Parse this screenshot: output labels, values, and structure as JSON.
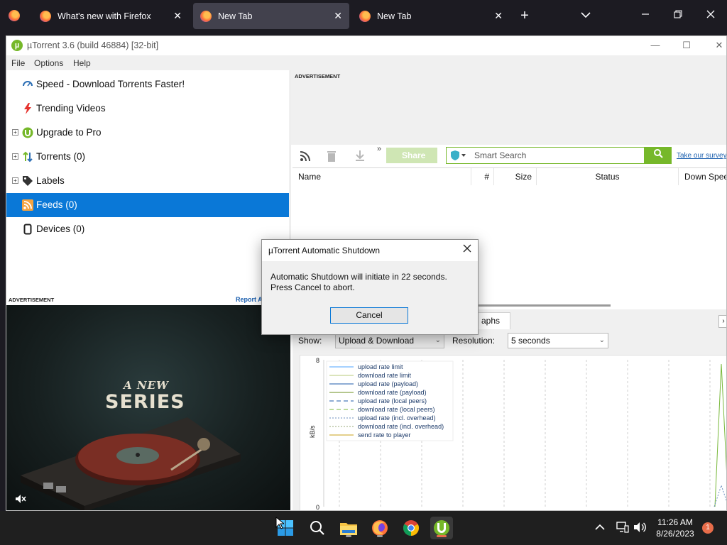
{
  "browser": {
    "tabs": [
      {
        "label": "What's new with Firefox",
        "active": false
      },
      {
        "label": "New Tab",
        "active": true
      },
      {
        "label": "New Tab",
        "active": false
      }
    ]
  },
  "app": {
    "title": "µTorrent 3.6  (build 46884) [32-bit]",
    "menu": [
      "File",
      "Options",
      "Help"
    ]
  },
  "sidebar": {
    "items": [
      {
        "label": "Speed - Download Torrents Faster!",
        "icon": "speed-gauge-icon"
      },
      {
        "label": "Trending Videos",
        "icon": "lightning-icon"
      },
      {
        "label": "Upgrade to Pro",
        "icon": "utorrent-logo-icon"
      },
      {
        "label": "Torrents (0)",
        "icon": "torrents-arrows-icon"
      },
      {
        "label": "Labels",
        "icon": "tag-icon"
      },
      {
        "label": "Feeds (0)",
        "icon": "rss-icon",
        "selected": true
      },
      {
        "label": "Devices (0)",
        "icon": "device-icon"
      }
    ]
  },
  "ads": {
    "left_label": "ADVERTISEMENT",
    "report_label": "Report A",
    "video_line1": "A NEW",
    "video_line2": "SERIES",
    "right_label": "ADVERTISEMENT"
  },
  "toolbar": {
    "share_label": "Share",
    "search_placeholder": "Smart Search",
    "survey_link": "Take our survey"
  },
  "table": {
    "columns": [
      "Name",
      "#",
      "Size",
      "Status",
      "Down Speed"
    ]
  },
  "details": {
    "tab_fragment": "aphs",
    "show_label": "Show:",
    "show_value": "Upload & Download",
    "resolution_label": "Resolution:",
    "resolution_value": "5 seconds"
  },
  "chart_data": {
    "type": "line",
    "ylabel": "kB/s",
    "ylim": [
      0,
      8
    ],
    "yticks": [
      "8",
      "0"
    ],
    "legend_position": "top-left",
    "series": [
      {
        "name": "upload rate limit",
        "color": "#4da3ff",
        "style": "solid"
      },
      {
        "name": "download rate limit",
        "color": "#b7c97a",
        "style": "solid"
      },
      {
        "name": "upload rate (payload)",
        "color": "#1e5aa8",
        "style": "solid"
      },
      {
        "name": "download rate (payload)",
        "color": "#6b8f1d",
        "style": "solid"
      },
      {
        "name": "upload rate (local peers)",
        "color": "#1e5aa8",
        "style": "dashed"
      },
      {
        "name": "download rate (local peers)",
        "color": "#78b83a",
        "style": "dashed"
      },
      {
        "name": "upload rate (incl. overhead)",
        "color": "#6b8fbf",
        "style": "dotted"
      },
      {
        "name": "download rate (incl. overhead)",
        "color": "#9aa87a",
        "style": "dotted"
      },
      {
        "name": "send rate to player",
        "color": "#c9a21a",
        "style": "solid"
      }
    ],
    "spike_series": {
      "name": "download rate (local peers)",
      "peak_value": 8
    }
  },
  "dialog": {
    "title": "µTorrent Automatic Shutdown",
    "line1": "Automatic Shutdown will initiate in 22 seconds.",
    "line2": "Press Cancel to abort.",
    "cancel_label": "Cancel"
  },
  "taskbar": {
    "time": "11:26 AM",
    "date": "8/26/2023",
    "notification_count": "1"
  }
}
